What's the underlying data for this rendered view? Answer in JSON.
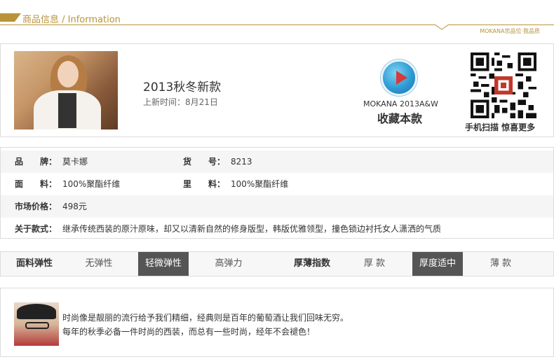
{
  "header": {
    "title": "商品信息 / Information",
    "slogan": "MOKANA您品位·我品质"
  },
  "product": {
    "name": "2013秋冬新款",
    "date": "上新时间：8月21日",
    "brand_text": "MOKANA 2013A&W",
    "collect_label": "收藏本款",
    "qr_caption": "手机扫描 惊喜更多"
  },
  "info": {
    "brand_label": "品　　牌：",
    "brand_value": "莫卡娜",
    "item_label": "货　　号：",
    "item_value": "8213",
    "fabric_label": "面　　料：",
    "fabric_value": "100%聚酯纤维",
    "lining_label": "里　　料：",
    "lining_value": "100%聚酯纤维",
    "price_label": "市场价格：",
    "price_value": "498元",
    "about_label": "关于款式：",
    "about_value": "继承传统西装的原汁原味，却又以清新自然的修身版型，韩版优雅领型，撞色锁边衬托女人潇洒的气质"
  },
  "attributes": {
    "elasticity_label": "面料弹性",
    "elasticity_options": [
      "无弹性",
      "轻微弹性",
      "高弹力"
    ],
    "elasticity_selected": "轻微弹性",
    "thickness_label": "厚薄指数",
    "thickness_options": [
      "厚 款",
      "厚度适中",
      "薄 款"
    ],
    "thickness_selected": "厚度适中"
  },
  "quote": {
    "line1": "时尚像是靓丽的流行给予我们精细，经典则是百年的葡萄酒让我们回味无穷。",
    "line2": "每年的秋季必备一件时尚的西装，而总有一些时尚，经年不会褪色！"
  },
  "colors": {
    "accent": "#b9933a",
    "selected": "#555555",
    "border": "#dddddd"
  }
}
